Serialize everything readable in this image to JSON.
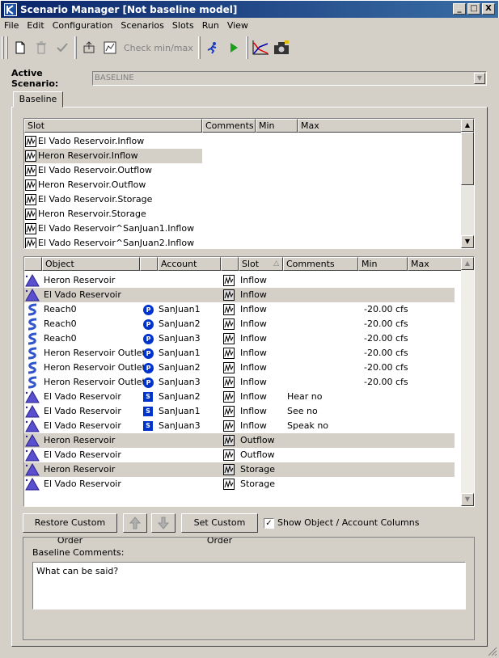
{
  "window": {
    "title": "Scenario Manager [Not baseline model]",
    "controls": [
      "_",
      "□",
      "X"
    ]
  },
  "menu": [
    "File",
    "Edit",
    "Configuration",
    "Scenarios",
    "Slots",
    "Run",
    "View"
  ],
  "toolbar": {
    "check_label": "Check min/max",
    "icons": [
      "new-icon",
      "delete-icon",
      "checkmark-icon",
      "export-icon",
      "chart-icon",
      "runner-icon",
      "play-icon",
      "plot-icon",
      "camera-icon"
    ]
  },
  "active_scenario": {
    "label": "Active Scenario:",
    "value": "BASELINE"
  },
  "tab": {
    "label": "Baseline"
  },
  "slot_table": {
    "columns": [
      "Slot",
      "Comments",
      "Min",
      "Max"
    ],
    "rows": [
      {
        "slot": "El Vado Reservoir.Inflow",
        "selected": false
      },
      {
        "slot": "Heron Reservoir.Inflow",
        "selected": true
      },
      {
        "slot": "El Vado Reservoir.Outflow",
        "selected": false
      },
      {
        "slot": "Heron Reservoir.Outflow",
        "selected": false
      },
      {
        "slot": "El Vado Reservoir.Storage",
        "selected": false
      },
      {
        "slot": "Heron Reservoir.Storage",
        "selected": false
      },
      {
        "slot": "El Vado Reservoir^SanJuan1.Inflow",
        "selected": false
      },
      {
        "slot": "El Vado Reservoir^SanJuan2.Inflow",
        "selected": false
      }
    ]
  },
  "object_table": {
    "columns": [
      "Object",
      "Account",
      "Slot",
      "Comments",
      "Min",
      "Max"
    ],
    "rows": [
      {
        "type": "reservoir",
        "object": "Heron Reservoir",
        "badge": "",
        "account": "",
        "slot": "Inflow",
        "comments": "",
        "min": "",
        "max": "",
        "selected": false
      },
      {
        "type": "reservoir",
        "object": "El Vado Reservoir",
        "badge": "",
        "account": "",
        "slot": "Inflow",
        "comments": "",
        "min": "",
        "max": "",
        "selected": true
      },
      {
        "type": "reach",
        "object": "Reach0",
        "badge": "P",
        "account": "SanJuan1",
        "slot": "Inflow",
        "comments": "",
        "min": "-20.00 cfs",
        "max": "",
        "selected": false
      },
      {
        "type": "reach",
        "object": "Reach0",
        "badge": "P",
        "account": "SanJuan2",
        "slot": "Inflow",
        "comments": "",
        "min": "-20.00 cfs",
        "max": "",
        "selected": false
      },
      {
        "type": "reach",
        "object": "Reach0",
        "badge": "P",
        "account": "SanJuan3",
        "slot": "Inflow",
        "comments": "",
        "min": "-20.00 cfs",
        "max": "",
        "selected": false
      },
      {
        "type": "reach",
        "object": "Heron Reservoir Outlet",
        "badge": "P",
        "account": "SanJuan1",
        "slot": "Inflow",
        "comments": "",
        "min": "-20.00 cfs",
        "max": "",
        "selected": false
      },
      {
        "type": "reach",
        "object": "Heron Reservoir Outlet",
        "badge": "P",
        "account": "SanJuan2",
        "slot": "Inflow",
        "comments": "",
        "min": "-20.00 cfs",
        "max": "",
        "selected": false
      },
      {
        "type": "reach",
        "object": "Heron Reservoir Outlet",
        "badge": "P",
        "account": "SanJuan3",
        "slot": "Inflow",
        "comments": "",
        "min": "-20.00 cfs",
        "max": "",
        "selected": false
      },
      {
        "type": "reservoir",
        "object": "El Vado Reservoir",
        "badge": "S",
        "account": "SanJuan2",
        "slot": "Inflow",
        "comments": "Hear no",
        "min": "",
        "max": "",
        "selected": false
      },
      {
        "type": "reservoir",
        "object": "El Vado Reservoir",
        "badge": "S",
        "account": "SanJuan1",
        "slot": "Inflow",
        "comments": "See no",
        "min": "",
        "max": "",
        "selected": false
      },
      {
        "type": "reservoir",
        "object": "El Vado Reservoir",
        "badge": "S",
        "account": "SanJuan3",
        "slot": "Inflow",
        "comments": "Speak no",
        "min": "",
        "max": "",
        "selected": false
      },
      {
        "type": "reservoir",
        "object": "Heron Reservoir",
        "badge": "",
        "account": "",
        "slot": "Outflow",
        "comments": "",
        "min": "",
        "max": "",
        "selected": true
      },
      {
        "type": "reservoir",
        "object": "El Vado Reservoir",
        "badge": "",
        "account": "",
        "slot": "Outflow",
        "comments": "",
        "min": "",
        "max": "",
        "selected": false
      },
      {
        "type": "reservoir",
        "object": "Heron Reservoir",
        "badge": "",
        "account": "",
        "slot": "Storage",
        "comments": "",
        "min": "",
        "max": "",
        "selected": true
      },
      {
        "type": "reservoir",
        "object": "El Vado Reservoir",
        "badge": "",
        "account": "",
        "slot": "Storage",
        "comments": "",
        "min": "",
        "max": "",
        "selected": false
      }
    ]
  },
  "buttons": {
    "restore": "Restore Custom Order",
    "set": "Set Custom Order",
    "show_columns": "Show Object / Account Columns",
    "show_columns_checked": true
  },
  "comments": {
    "label": "Baseline Comments:",
    "value": "What can be said?"
  }
}
